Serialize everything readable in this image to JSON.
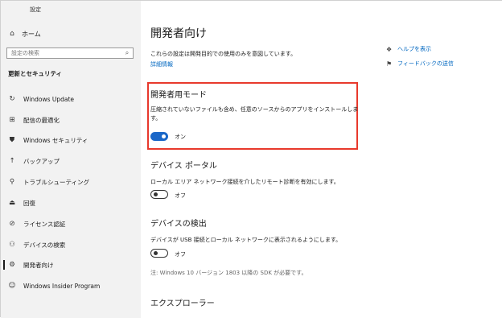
{
  "window": {
    "title": "設定"
  },
  "sidebar": {
    "home_label": "ホーム",
    "search_placeholder": "設定の検索",
    "section_title": "更新とセキュリティ",
    "items": [
      {
        "label": "Windows Update",
        "icon": "refresh-icon"
      },
      {
        "label": "配信の最適化",
        "icon": "delivery-optimization-icon"
      },
      {
        "label": "Windows セキュリティ",
        "icon": "shield-icon"
      },
      {
        "label": "バックアップ",
        "icon": "backup-arrow-icon"
      },
      {
        "label": "トラブルシューティング",
        "icon": "wrench-icon"
      },
      {
        "label": "回復",
        "icon": "recovery-icon"
      },
      {
        "label": "ライセンス認証",
        "icon": "check-circle-icon"
      },
      {
        "label": "デバイスの検索",
        "icon": "person-location-icon"
      },
      {
        "label": "開発者向け",
        "icon": "developer-icon",
        "selected": true
      },
      {
        "label": "Windows Insider Program",
        "icon": "insider-icon"
      }
    ]
  },
  "main": {
    "page_title": "開発者向け",
    "description": "これらの設定は開発目的での使用のみを意図しています。",
    "details_link": "詳細情報",
    "help_link": "ヘルプを表示",
    "feedback_link": "フィードバックの送信",
    "dev_mode": {
      "title": "開発者用モード",
      "description_line1": "圧縮されていないファイルも含め、任意のソースからのアプリをインストールしま",
      "description_line2": "す。",
      "toggle_label": "オン",
      "toggle_on": true
    },
    "device_portal": {
      "title": "デバイス ポータル",
      "description": "ローカル エリア ネットワーク接続を介したリモート診断を有効にします。",
      "toggle_label": "オフ",
      "toggle_on": false
    },
    "device_discovery": {
      "title": "デバイスの検出",
      "description": "デバイスが USB 接続とローカル ネットワークに表示されるようにします。",
      "toggle_label": "オフ",
      "toggle_on": false,
      "note": "注: Windows 10 バージョン 1803 以降の SDK が必要です。"
    },
    "explorer": {
      "title": "エクスプローラー"
    }
  },
  "colors": {
    "accent": "#0067c0",
    "toggle_on": "#1a67c8",
    "highlight_border": "#e8392c",
    "sidebar_bg": "#f2f2f2"
  }
}
